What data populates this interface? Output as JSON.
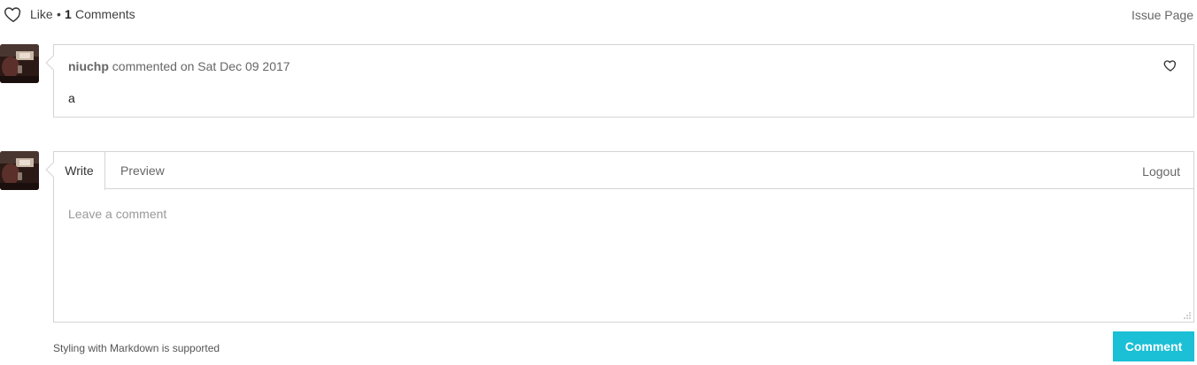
{
  "header": {
    "like_label": "Like",
    "separator": "•",
    "comment_count": "1",
    "comments_word": "Comments",
    "issue_page_label": "Issue Page"
  },
  "comments": [
    {
      "author": "niuchp",
      "action": "commented on",
      "date": "Sat Dec 09 2017",
      "body": "a"
    }
  ],
  "editor": {
    "tab_write": "Write",
    "tab_preview": "Preview",
    "logout_label": "Logout",
    "placeholder": "Leave a comment",
    "value": ""
  },
  "footer": {
    "markdown_note": "Styling with Markdown is supported",
    "submit_label": "Comment"
  },
  "colors": {
    "accent": "#1bbfd6",
    "border": "#d4d4d4",
    "muted_text": "#666666"
  },
  "icons": {
    "like": "heart-outline-icon",
    "comment_like": "heart-outline-icon",
    "resize": "resize-grip-icon"
  }
}
